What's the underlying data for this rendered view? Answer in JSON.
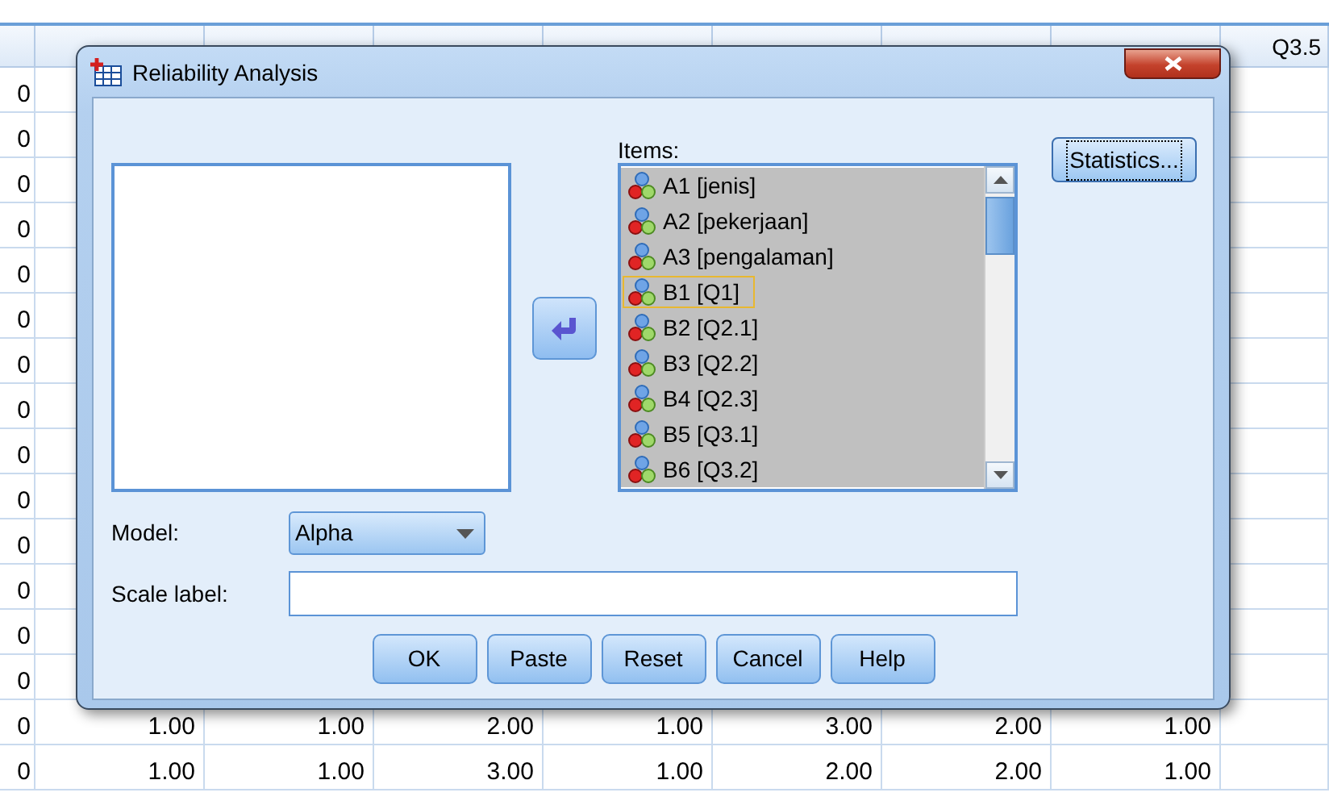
{
  "spreadsheet": {
    "visible_header": "Q3.5",
    "rows": [
      {
        "stub": "0",
        "values": []
      },
      {
        "stub": "0",
        "values": []
      },
      {
        "stub": "0",
        "values": []
      },
      {
        "stub": "0",
        "values": []
      },
      {
        "stub": "0",
        "values": []
      },
      {
        "stub": "0",
        "values": []
      },
      {
        "stub": "0",
        "values": []
      },
      {
        "stub": "0",
        "values": []
      },
      {
        "stub": "0",
        "values": []
      },
      {
        "stub": "0",
        "values": []
      },
      {
        "stub": "0",
        "values": []
      },
      {
        "stub": "0",
        "values": []
      },
      {
        "stub": "0",
        "values": []
      },
      {
        "stub": "0",
        "values": []
      },
      {
        "stub": "0",
        "values": [
          "1.00",
          "1.00",
          "2.00",
          "1.00",
          "3.00",
          "2.00",
          "1.00"
        ]
      },
      {
        "stub": "0",
        "values": [
          "1.00",
          "1.00",
          "3.00",
          "1.00",
          "2.00",
          "2.00",
          "1.00"
        ]
      }
    ]
  },
  "dialog": {
    "title": "Reliability Analysis",
    "items_label": "Items:",
    "items": [
      {
        "label": "A1 [jenis]",
        "selected": true,
        "focused": false
      },
      {
        "label": "A2 [pekerjaan]",
        "selected": true,
        "focused": false
      },
      {
        "label": "A3 [pengalaman]",
        "selected": true,
        "focused": false
      },
      {
        "label": "B1 [Q1]",
        "selected": true,
        "focused": true
      },
      {
        "label": "B2 [Q2.1]",
        "selected": true,
        "focused": false
      },
      {
        "label": "B3 [Q2.2]",
        "selected": true,
        "focused": false
      },
      {
        "label": "B4 [Q2.3]",
        "selected": true,
        "focused": false
      },
      {
        "label": "B5 [Q3.1]",
        "selected": true,
        "focused": false
      },
      {
        "label": "B6 [Q3.2]",
        "selected": true,
        "focused": false
      }
    ],
    "statistics_button": {
      "label": "Statistics...",
      "focused": true
    },
    "model_label": "Model:",
    "model_value": "Alpha",
    "scale_label": "Scale label:",
    "buttons": [
      "OK",
      "Paste",
      "Reset",
      "Cancel",
      "Help"
    ]
  }
}
